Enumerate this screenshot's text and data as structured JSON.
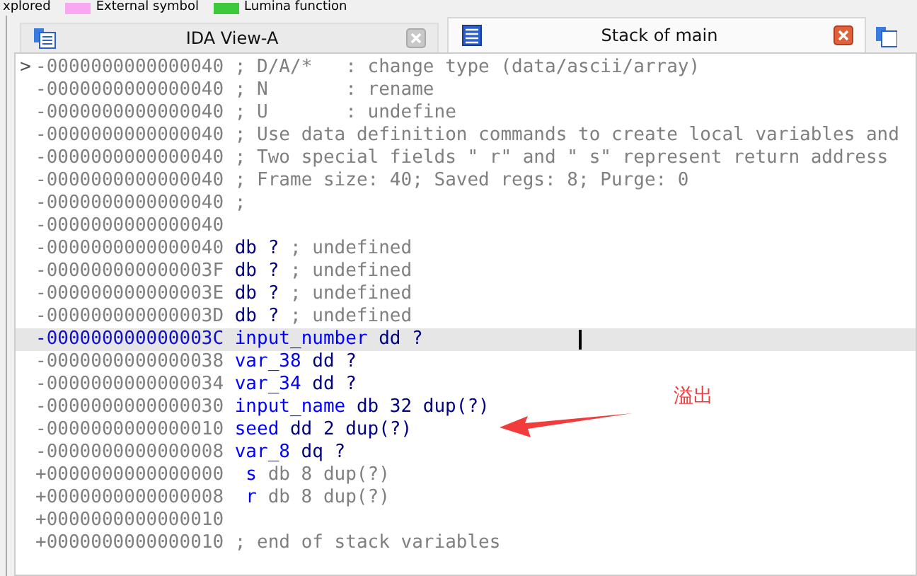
{
  "legend": [
    {
      "label": "xplored"
    },
    {
      "label": "External symbol",
      "color": "#f7a8f0"
    },
    {
      "label": "Lumina function",
      "color": "#3ec83e"
    }
  ],
  "tabs": [
    {
      "label": "IDA View-A",
      "selected": false
    },
    {
      "label": "Stack of main",
      "selected": true
    }
  ],
  "listing": [
    {
      "address": "-0000000000000040",
      "prompt": ">",
      "selected": false,
      "parts": [
        {
          "kind": "comment",
          "text": "; D/A/*   : change type (data/ascii/array)"
        }
      ]
    },
    {
      "address": "-0000000000000040",
      "selected": false,
      "parts": [
        {
          "kind": "comment",
          "text": "; N       : rename"
        }
      ]
    },
    {
      "address": "-0000000000000040",
      "selected": false,
      "parts": [
        {
          "kind": "comment",
          "text": "; U       : undefine"
        }
      ]
    },
    {
      "address": "-0000000000000040",
      "selected": false,
      "parts": [
        {
          "kind": "comment",
          "text": "; Use data definition commands to create local variables and"
        }
      ]
    },
    {
      "address": "-0000000000000040",
      "selected": false,
      "parts": [
        {
          "kind": "comment",
          "text": "; Two special fields \" r\" and \" s\" represent return address"
        }
      ]
    },
    {
      "address": "-0000000000000040",
      "selected": false,
      "parts": [
        {
          "kind": "comment",
          "text": "; Frame size: 40; Saved regs: 8; Purge: 0"
        }
      ]
    },
    {
      "address": "-0000000000000040",
      "selected": false,
      "parts": [
        {
          "kind": "comment",
          "text": ";"
        }
      ]
    },
    {
      "address": "-0000000000000040",
      "selected": false
    },
    {
      "address": "-0000000000000040",
      "selected": false,
      "parts": [
        {
          "kind": "code",
          "text": "db ?"
        },
        {
          "kind": "comment",
          "text": "; undefined"
        }
      ]
    },
    {
      "address": "-000000000000003F",
      "selected": false,
      "parts": [
        {
          "kind": "code",
          "text": "db ?"
        },
        {
          "kind": "comment",
          "text": "; undefined"
        }
      ]
    },
    {
      "address": "-000000000000003E",
      "selected": false,
      "parts": [
        {
          "kind": "code",
          "text": "db ?"
        },
        {
          "kind": "comment",
          "text": "; undefined"
        }
      ]
    },
    {
      "address": "-000000000000003D",
      "selected": false,
      "parts": [
        {
          "kind": "code",
          "text": "db ?"
        },
        {
          "kind": "comment",
          "text": "; undefined"
        }
      ]
    },
    {
      "address": "-000000000000003C",
      "selected": true,
      "parts": [
        {
          "kind": "name",
          "text": "input_number"
        },
        {
          "kind": "code",
          "text": "dd ?"
        }
      ]
    },
    {
      "address": "-0000000000000038",
      "selected": false,
      "parts": [
        {
          "kind": "name",
          "text": "var_38"
        },
        {
          "kind": "code",
          "text": "dd ?"
        }
      ]
    },
    {
      "address": "-0000000000000034",
      "selected": false,
      "parts": [
        {
          "kind": "name",
          "text": "var_34"
        },
        {
          "kind": "code",
          "text": "dd ?"
        }
      ]
    },
    {
      "address": "-0000000000000030",
      "selected": false,
      "parts": [
        {
          "kind": "name",
          "text": "input_name"
        },
        {
          "kind": "code",
          "text": "db 32 dup(?)"
        }
      ]
    },
    {
      "address": "-0000000000000010",
      "selected": false,
      "parts": [
        {
          "kind": "name",
          "text": "seed"
        },
        {
          "kind": "code",
          "text": "dd 2 dup(?)"
        }
      ]
    },
    {
      "address": "-0000000000000008",
      "selected": false,
      "parts": [
        {
          "kind": "name",
          "text": "var_8"
        },
        {
          "kind": "code",
          "text": "dq ?"
        }
      ]
    },
    {
      "address": "+0000000000000000",
      "selected": false,
      "parts": [
        {
          "kind": "name",
          "text": " s"
        },
        {
          "kind": "comment",
          "text": "db 8 dup(?)"
        }
      ]
    },
    {
      "address": "+0000000000000008",
      "selected": false,
      "parts": [
        {
          "kind": "name",
          "text": " r"
        },
        {
          "kind": "comment",
          "text": "db 8 dup(?)"
        }
      ]
    },
    {
      "address": "+0000000000000010",
      "selected": false
    },
    {
      "address": "+0000000000000010",
      "selected": false,
      "parts": [
        {
          "kind": "comment",
          "text": "; end of stack variables"
        }
      ]
    }
  ],
  "annotation": {
    "label": "溢出"
  }
}
